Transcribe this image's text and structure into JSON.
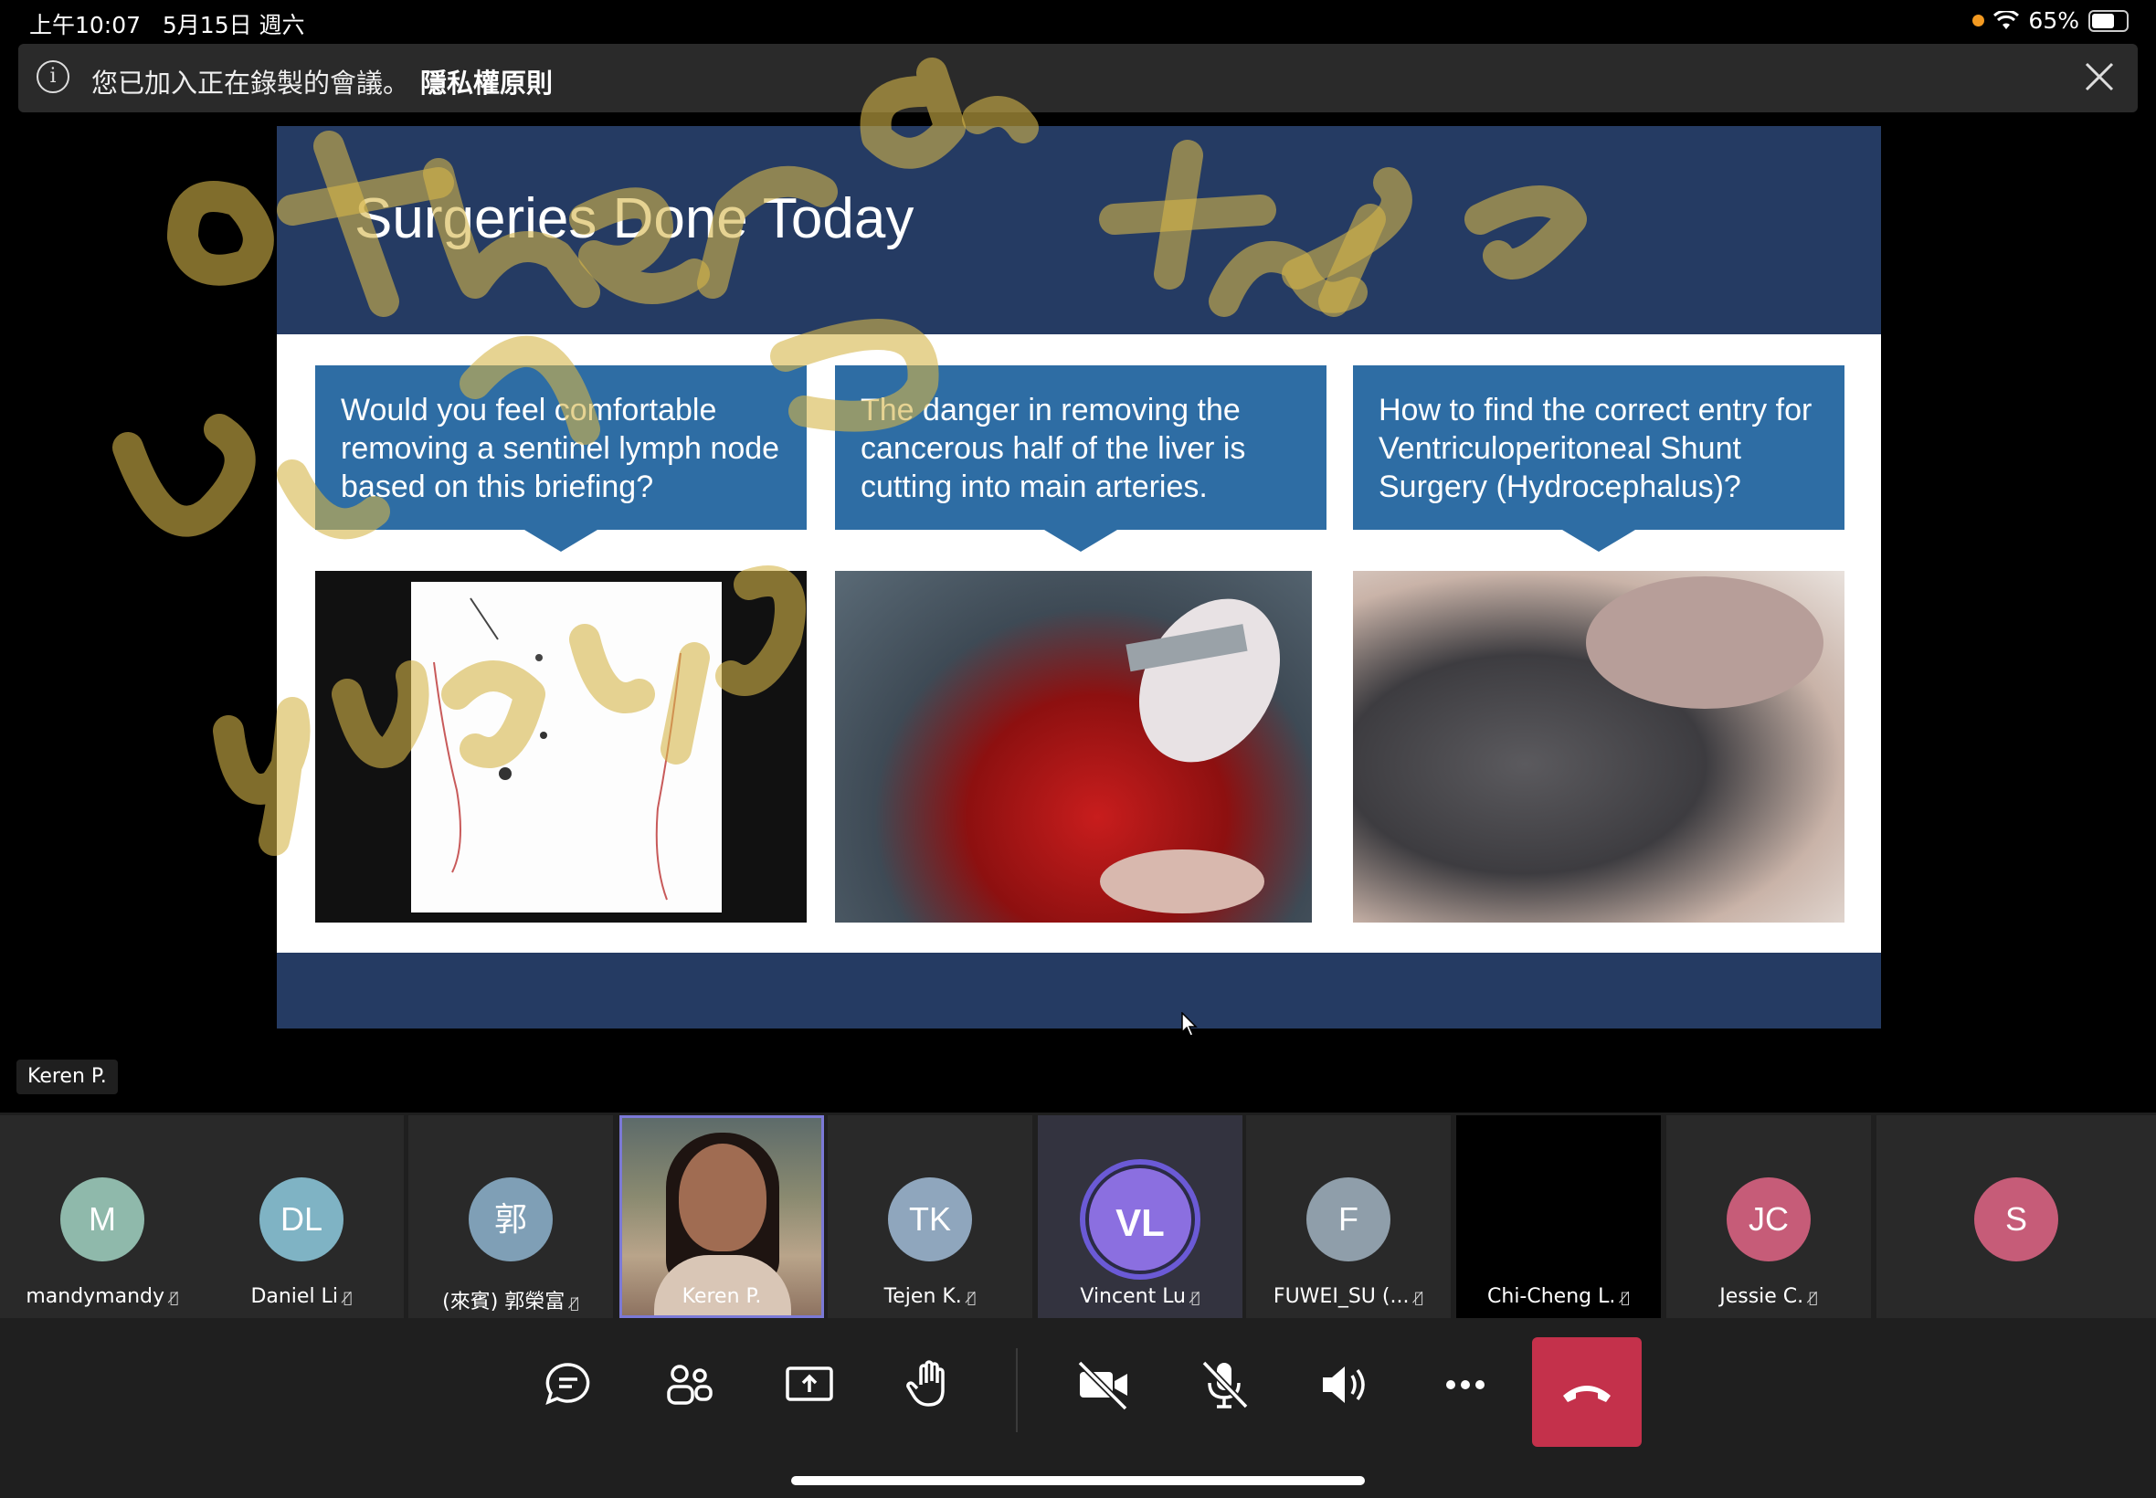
{
  "status_bar": {
    "time": "上午10:07",
    "date": "5月15日 週六",
    "battery": "65%"
  },
  "banner": {
    "message": "您已加入正在錄製的會議。",
    "link": "隱私權原則"
  },
  "slide": {
    "title": "Surgeries Done Today",
    "questions": [
      "Would you feel comfortable removing a sentinel lymph node based on this briefing?",
      "The danger in removing the cancerous half of the liver is cutting into main arteries.",
      "How to find the correct entry for Ventriculoperitoneal Shunt Surgery (Hydrocephalus)?"
    ]
  },
  "presenter_label": "Keren P.",
  "participants": [
    {
      "initials": "M",
      "name": "mandymandy",
      "color": "#8fb9ab"
    },
    {
      "initials": "DL",
      "name": "Daniel Li",
      "color": "#7fb3c4"
    },
    {
      "initials": "郭",
      "name": "(來賓) 郭榮富",
      "color": "#7f9fb6"
    },
    {
      "initials": "",
      "name": "Keren P.",
      "color": ""
    },
    {
      "initials": "TK",
      "name": "Tejen K.",
      "color": "#8fa6bd"
    },
    {
      "initials": "VL",
      "name": "Vincent Lu",
      "color": "#8b6fe0"
    },
    {
      "initials": "F",
      "name": "FUWEI_SU (...",
      "color": "#8f9eaa"
    },
    {
      "initials": "",
      "name": "Chi-Cheng L.",
      "color": ""
    },
    {
      "initials": "JC",
      "name": "Jessie C.",
      "color": "#c65c78"
    },
    {
      "initials": "S",
      "name": "",
      "color": "#c65c78"
    }
  ],
  "controls": [
    "chat-icon",
    "participants-icon",
    "share-screen-icon",
    "raise-hand-icon",
    "camera-off-icon",
    "mic-off-icon",
    "speaker-icon",
    "more-icon",
    "hang-up-icon"
  ]
}
